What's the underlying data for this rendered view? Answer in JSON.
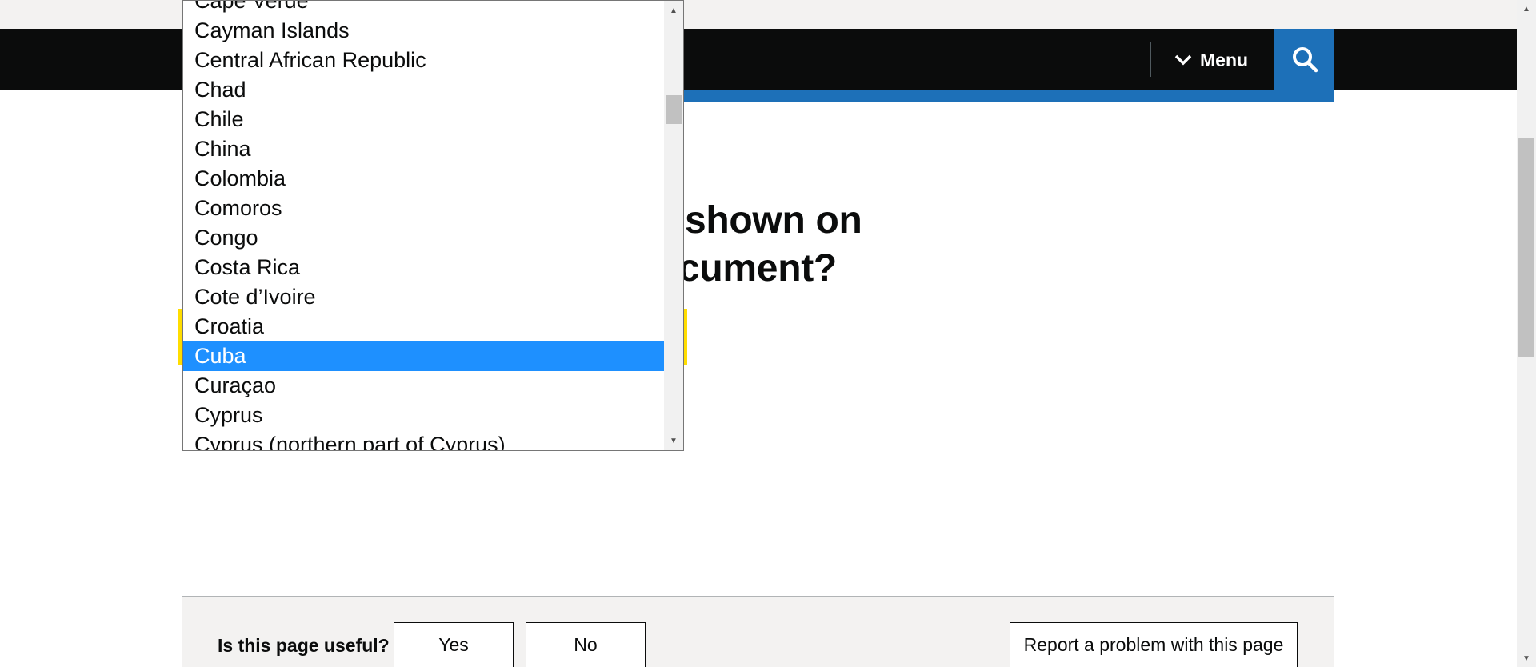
{
  "header": {
    "menu_label": "Menu",
    "menu_icon": "chevron-down-icon",
    "search_icon": "search-icon",
    "brand_color": "#0b0c0c",
    "accent_color": "#1d70b8"
  },
  "question": {
    "line1": "shown on",
    "line2": "cument?"
  },
  "dropdown": {
    "items": [
      "Cape Verde",
      "Cayman Islands",
      "Central African Republic",
      "Chad",
      "Chile",
      "China",
      "Colombia",
      "Comoros",
      "Congo",
      "Costa Rica",
      "Cote d’Ivoire",
      "Croatia",
      "Cuba",
      "Curaçao",
      "Cyprus",
      "Cyprus (northern part of Cyprus)"
    ],
    "selected": "Cuba",
    "selected_color": "#1e90ff"
  },
  "feedback": {
    "question": "Is this page useful?",
    "yes_label": "Yes",
    "no_label": "No",
    "report_label": "Report a problem with this page"
  }
}
